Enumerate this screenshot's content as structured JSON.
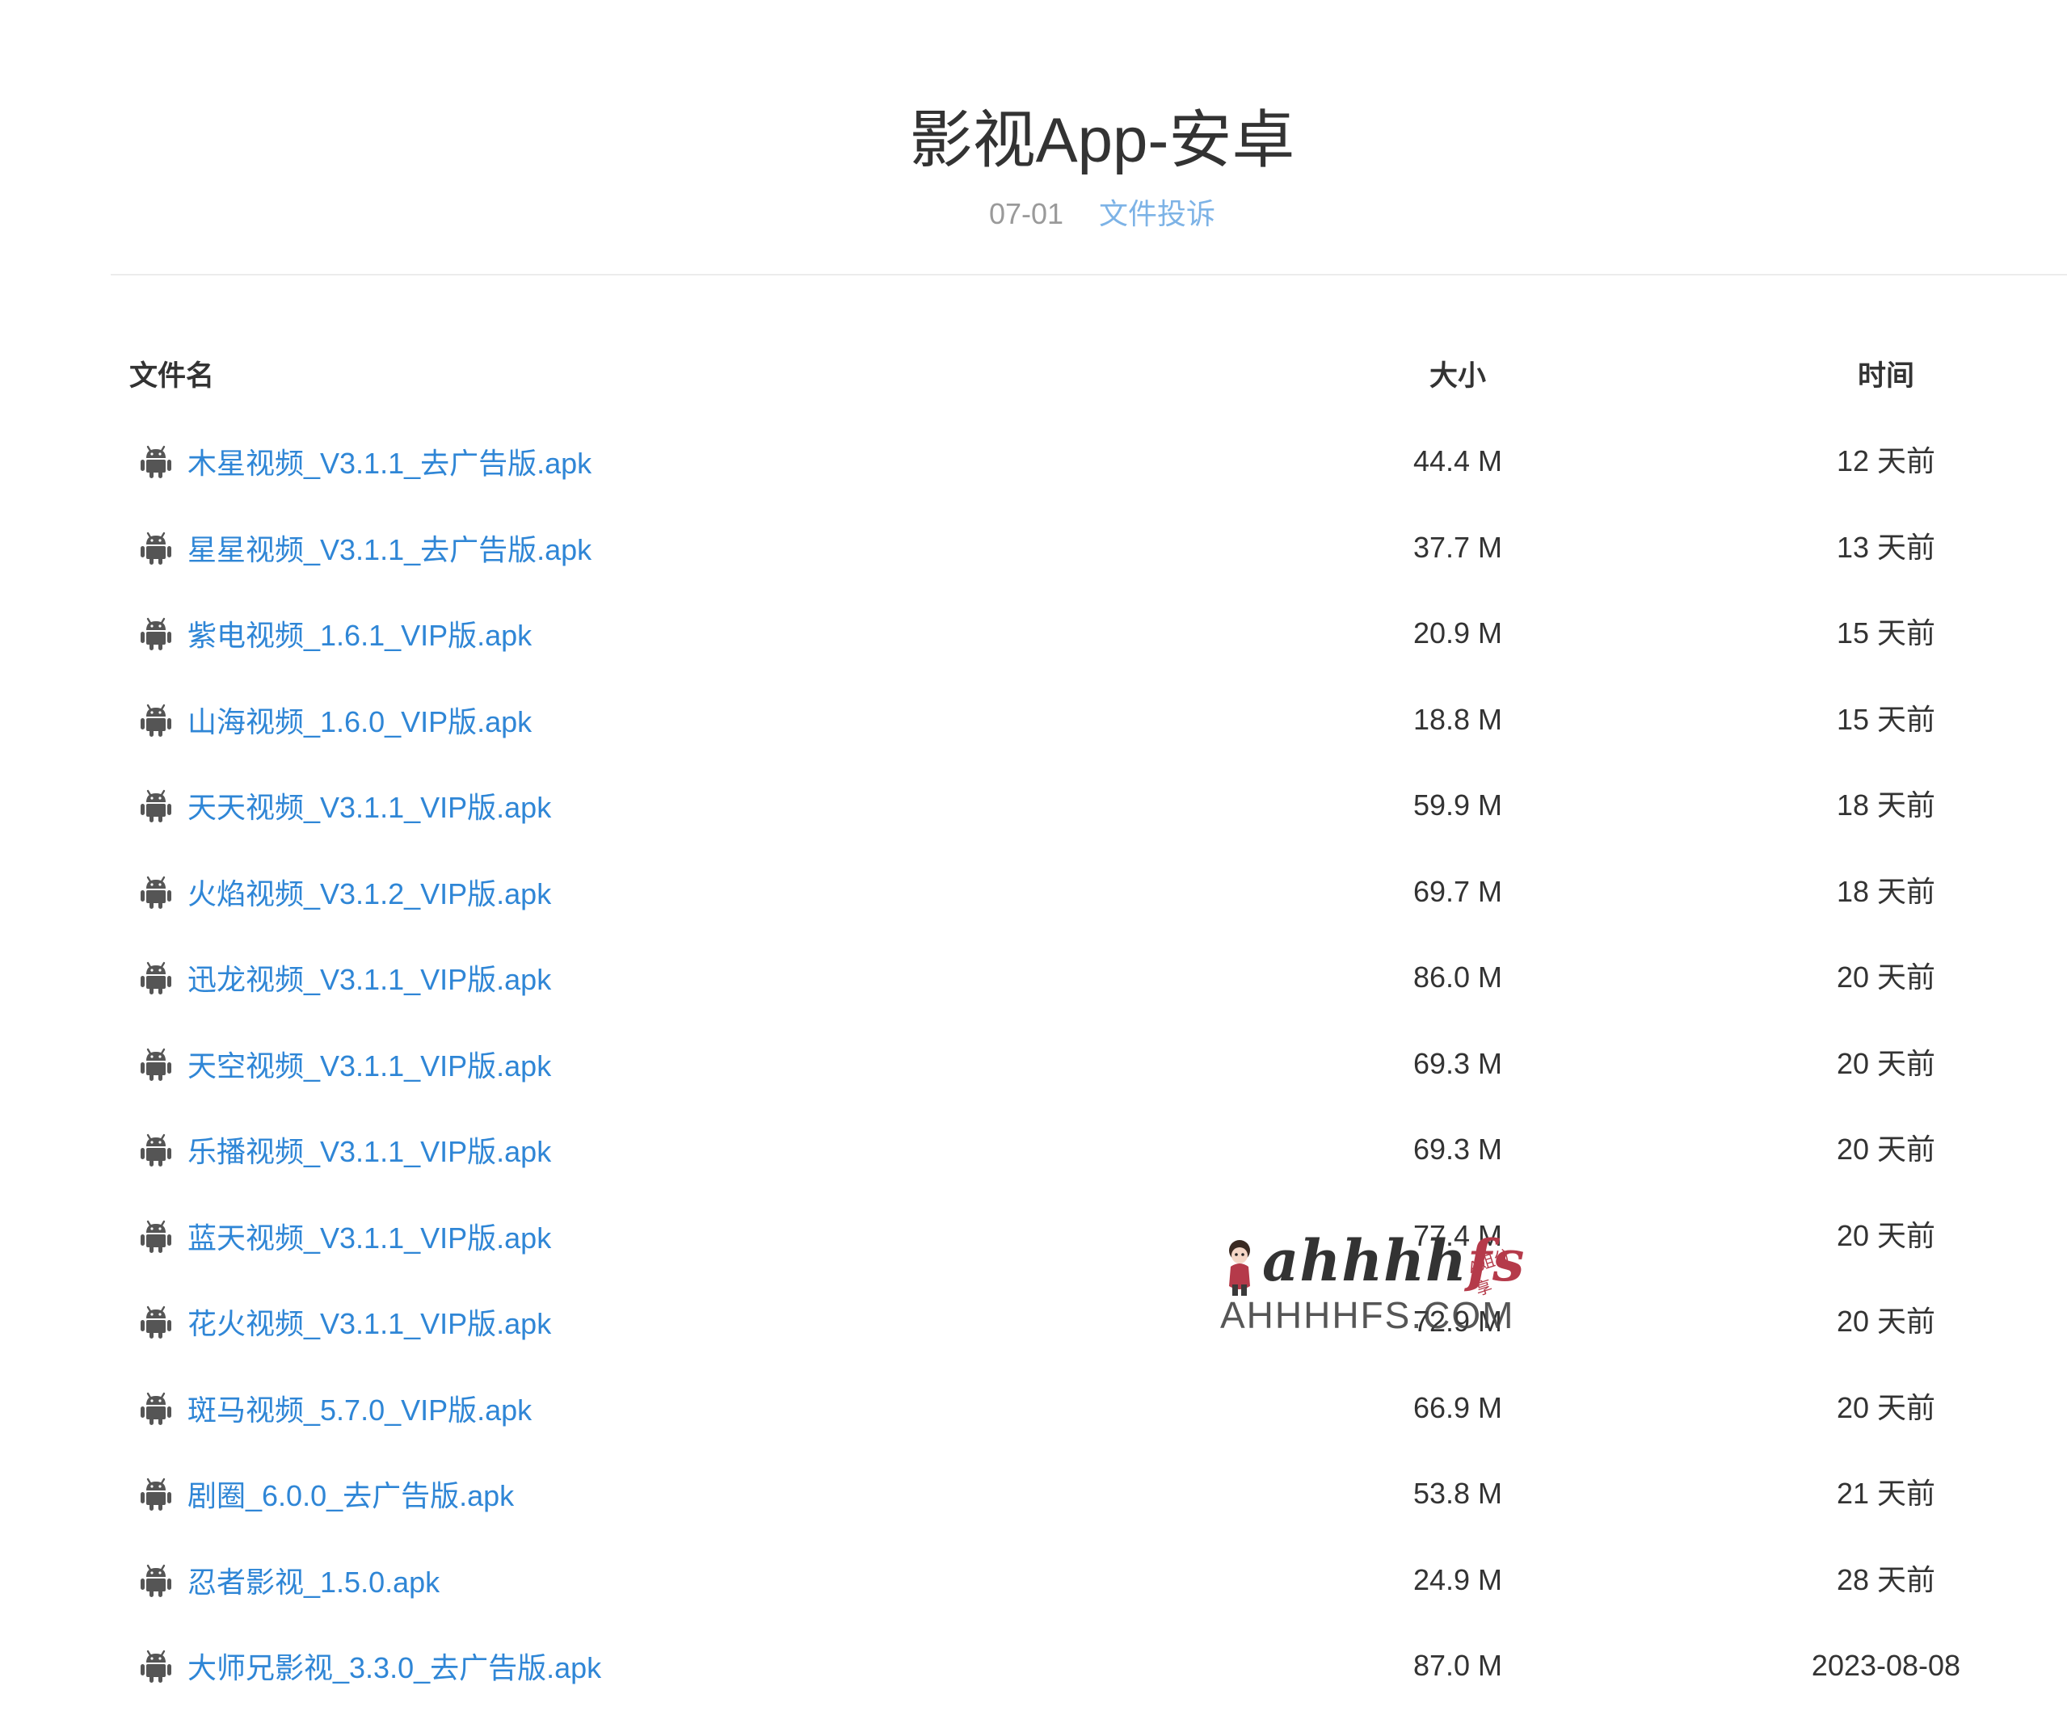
{
  "page": {
    "title": "影视App-安卓",
    "date": "07-01",
    "report_link": "文件投诉"
  },
  "table": {
    "headers": {
      "name": "文件名",
      "size": "大小",
      "time": "时间"
    },
    "file_icon": "android-icon",
    "link_color": "#2f86d6",
    "rows": [
      {
        "name": "木星视频_V3.1.1_去广告版.apk",
        "size": "44.4 M",
        "time": "12 天前"
      },
      {
        "name": "星星视频_V3.1.1_去广告版.apk",
        "size": "37.7 M",
        "time": "13 天前"
      },
      {
        "name": "紫电视频_1.6.1_VIP版.apk",
        "size": "20.9 M",
        "time": "15 天前"
      },
      {
        "name": "山海视频_1.6.0_VIP版.apk",
        "size": "18.8 M",
        "time": "15 天前"
      },
      {
        "name": "天天视频_V3.1.1_VIP版.apk",
        "size": "59.9 M",
        "time": "18 天前"
      },
      {
        "name": "火焰视频_V3.1.2_VIP版.apk",
        "size": "69.7 M",
        "time": "18 天前"
      },
      {
        "name": "迅龙视频_V3.1.1_VIP版.apk",
        "size": "86.0 M",
        "time": "20 天前"
      },
      {
        "name": "天空视频_V3.1.1_VIP版.apk",
        "size": "69.3 M",
        "time": "20 天前"
      },
      {
        "name": "乐播视频_V3.1.1_VIP版.apk",
        "size": "69.3 M",
        "time": "20 天前"
      },
      {
        "name": "蓝天视频_V3.1.1_VIP版.apk",
        "size": "77.4 M",
        "time": "20 天前"
      },
      {
        "name": "花火视频_V3.1.1_VIP版.apk",
        "size": "72.9 M",
        "time": "20 天前"
      },
      {
        "name": "斑马视频_5.7.0_VIP版.apk",
        "size": "66.9 M",
        "time": "20 天前"
      },
      {
        "name": "剧圈_6.0.0_去广告版.apk",
        "size": "53.8 M",
        "time": "21 天前"
      },
      {
        "name": "忍者影视_1.5.0.apk",
        "size": "24.9 M",
        "time": "28 天前"
      },
      {
        "name": "大师兄影视_3.3.0_去广告版.apk",
        "size": "87.0 M",
        "time": "2023-08-08"
      }
    ]
  },
  "watermark": {
    "script_text": "ahhhhfs",
    "tag": "A姐分享",
    "domain": "AHHHHFS.COM"
  }
}
